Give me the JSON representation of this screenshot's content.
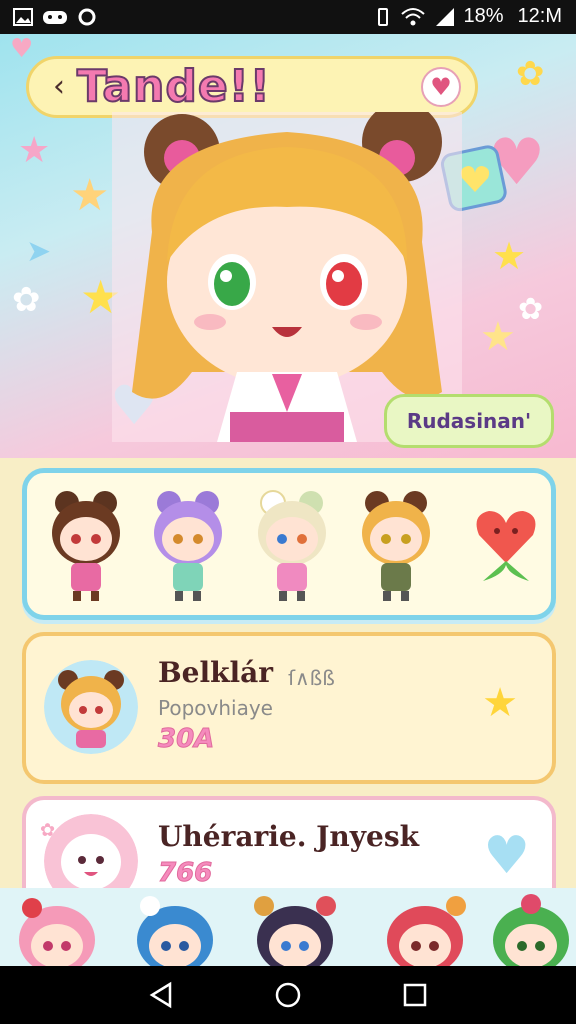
{
  "status_bar": {
    "battery": "18%",
    "time": "12:M"
  },
  "header": {
    "back_icon": "‹",
    "title": "Tande!!",
    "favorite_icon": "heart-icon"
  },
  "hero": {
    "badge": "Rudasinan'"
  },
  "character_strip": {
    "items": [
      "brown-hair-chibi",
      "purple-hair-chibi",
      "cream-hair-chibi",
      "blonde-hair-chibi",
      "heart-flower-icon"
    ]
  },
  "cards": [
    {
      "name": "Belklár",
      "tag": "ſ∧ßß",
      "subtitle": "Popovhiaye",
      "number": "30A"
    },
    {
      "name": "Uhérarie. Jnyesk",
      "number": "766"
    }
  ],
  "colors": {
    "accent_pink": "#f47ab0",
    "strip_border": "#7fd3ea",
    "card_border": "#f4c76f"
  }
}
